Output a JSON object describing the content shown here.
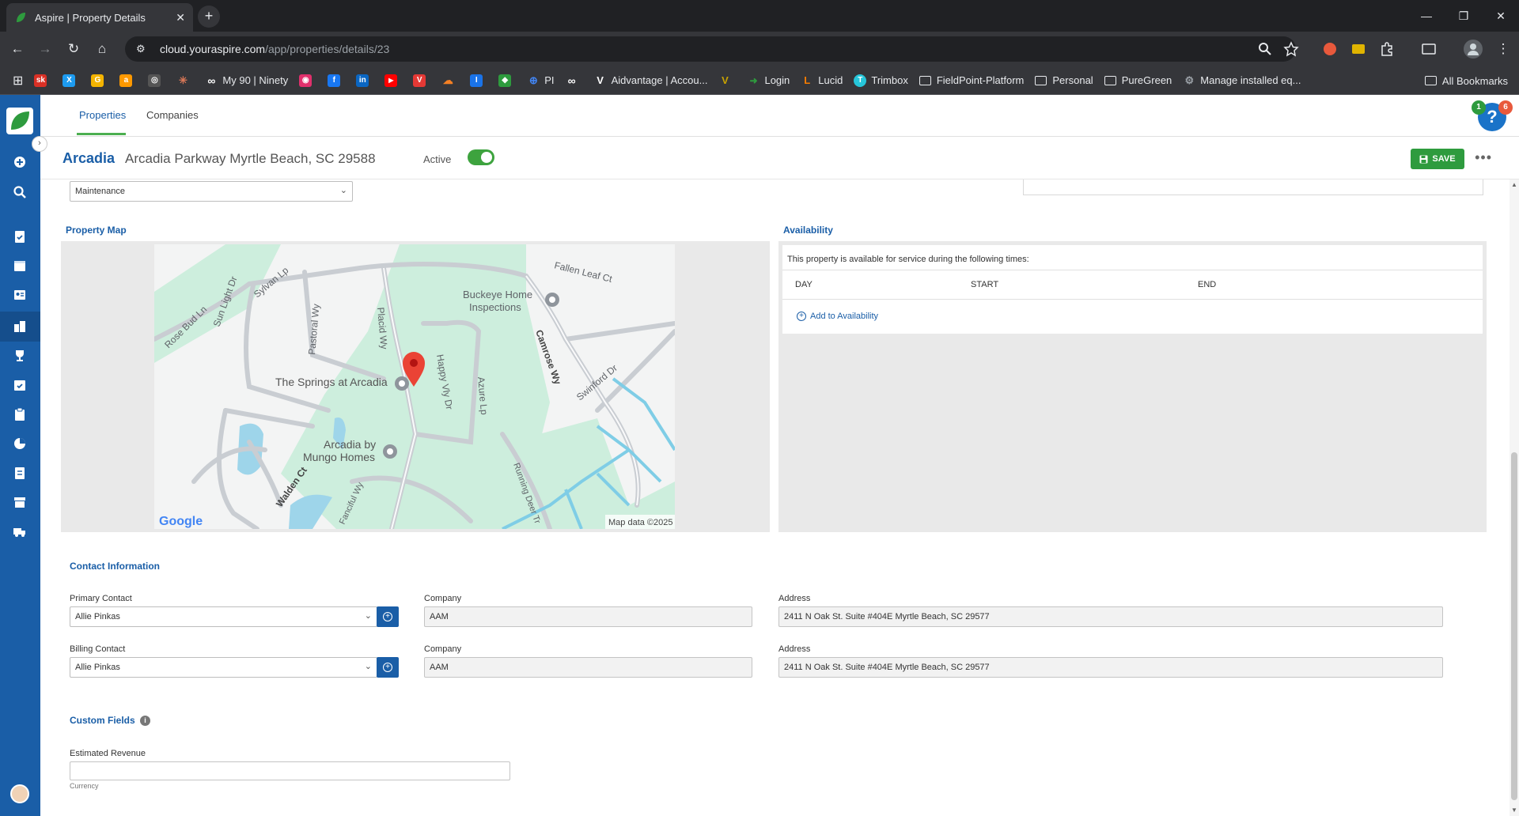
{
  "browser": {
    "tab_title": "Aspire | Property Details",
    "url_domain": "cloud.youraspire.com",
    "url_path": "/app/properties/details/23",
    "bookmarks": [
      {
        "label": "",
        "color": "#d93025",
        "text": "sk"
      },
      {
        "label": "",
        "color": "#1d9bf0",
        "text": "X"
      },
      {
        "label": "",
        "color": "#f4b400",
        "text": "G"
      },
      {
        "label": "",
        "color": "#ff9900",
        "text": "a"
      },
      {
        "label": "",
        "color": "#555555",
        "text": "◎"
      },
      {
        "label": "",
        "color": "#d97757",
        "text": "✳"
      },
      {
        "label": "My 90 | Ninety",
        "color": "#35363a",
        "text": "∞"
      },
      {
        "label": "",
        "color": "#e1306c",
        "text": "◉"
      },
      {
        "label": "",
        "color": "#1877f2",
        "text": "f"
      },
      {
        "label": "",
        "color": "#0a66c2",
        "text": "in"
      },
      {
        "label": "",
        "color": "#ff0000",
        "text": "▶"
      },
      {
        "label": "",
        "color": "#e53935",
        "text": "V"
      },
      {
        "label": "",
        "color": "#f48024",
        "text": "☁"
      },
      {
        "label": "",
        "color": "#1a73e8",
        "text": "I"
      },
      {
        "label": "",
        "color": "#2e9b3e",
        "text": "◆"
      },
      {
        "label": "PI",
        "color": "#4285f4",
        "text": "⊕"
      },
      {
        "label": "",
        "color": "#35363a",
        "text": "∞"
      },
      {
        "label": "Aidvantage | Accou...",
        "color": "#35363a",
        "text": "V"
      },
      {
        "label": "",
        "color": "#c8a200",
        "text": "V"
      },
      {
        "label": "Login",
        "color": "#2e9b3e",
        "text": "➜"
      },
      {
        "label": "Lucid",
        "color": "#f57c00",
        "text": "L"
      },
      {
        "label": "Trimbox",
        "color": "#26c6da",
        "text": "T"
      }
    ],
    "folders": [
      "FieldPoint-Platform",
      "Personal",
      "PureGreen"
    ],
    "last_bookmark": "Manage installed eq...",
    "all_bookmarks": "All Bookmarks"
  },
  "topnav": {
    "tabs": [
      "Properties",
      "Companies"
    ],
    "active_tab": "Properties",
    "badge_left": "1",
    "badge_right": "6",
    "help_glyph": "?"
  },
  "property": {
    "name": "Arcadia",
    "address": "Arcadia Parkway Myrtle Beach, SC 29588",
    "active_label": "Active",
    "active": true,
    "save_label": "SAVE"
  },
  "form": {
    "property_type_value": "Maintenance"
  },
  "map_section": {
    "title": "Property Map",
    "labels": {
      "fallen_leaf": "Fallen Leaf Ct",
      "buckeye_1": "Buckeye Home",
      "buckeye_2": "Inspections",
      "sylvan": "Sylvan Lp",
      "sun_light": "Sun Light Dr",
      "rose_bud": "Rose Bud Ln",
      "pastoral": "Pastoral Wy",
      "placid": "Placid Wy",
      "camrose": "Camrose Wy",
      "happy": "Happy Vly Dr",
      "azure": "Azure Lp",
      "springs": "The Springs at Arcadia",
      "swinford": "Swinford Dr",
      "arcadia_1": "Arcadia by",
      "arcadia_2": "Mungo Homes",
      "walden": "Walden Ct",
      "fanciful": "Fanciful Wy",
      "running_deer": "Running Deer Tr",
      "google": "Google",
      "map_data": "Map data ©2025"
    }
  },
  "availability": {
    "title": "Availability",
    "intro": "This property is available for service during the following times:",
    "columns": [
      "DAY",
      "START",
      "END"
    ],
    "add_link": "Add to Availability"
  },
  "contact": {
    "title": "Contact Information",
    "primary_label": "Primary Contact",
    "primary_value": "Allie Pinkas",
    "billing_label": "Billing Contact",
    "billing_value": "Allie Pinkas",
    "company_label": "Company",
    "company_value": "AAM",
    "address_label": "Address",
    "address_value": "2411 N Oak St. Suite #404E Myrtle Beach, SC 29577"
  },
  "custom_fields": {
    "title": "Custom Fields",
    "estimated_revenue_label": "Estimated Revenue",
    "estimated_revenue_value": "",
    "currency_hint": "Currency"
  },
  "colors": {
    "brand_blue": "#1a5ea7",
    "save_green": "#2e9b3e",
    "toggle_green": "#3da33e",
    "map_green": "#cdeedd"
  }
}
